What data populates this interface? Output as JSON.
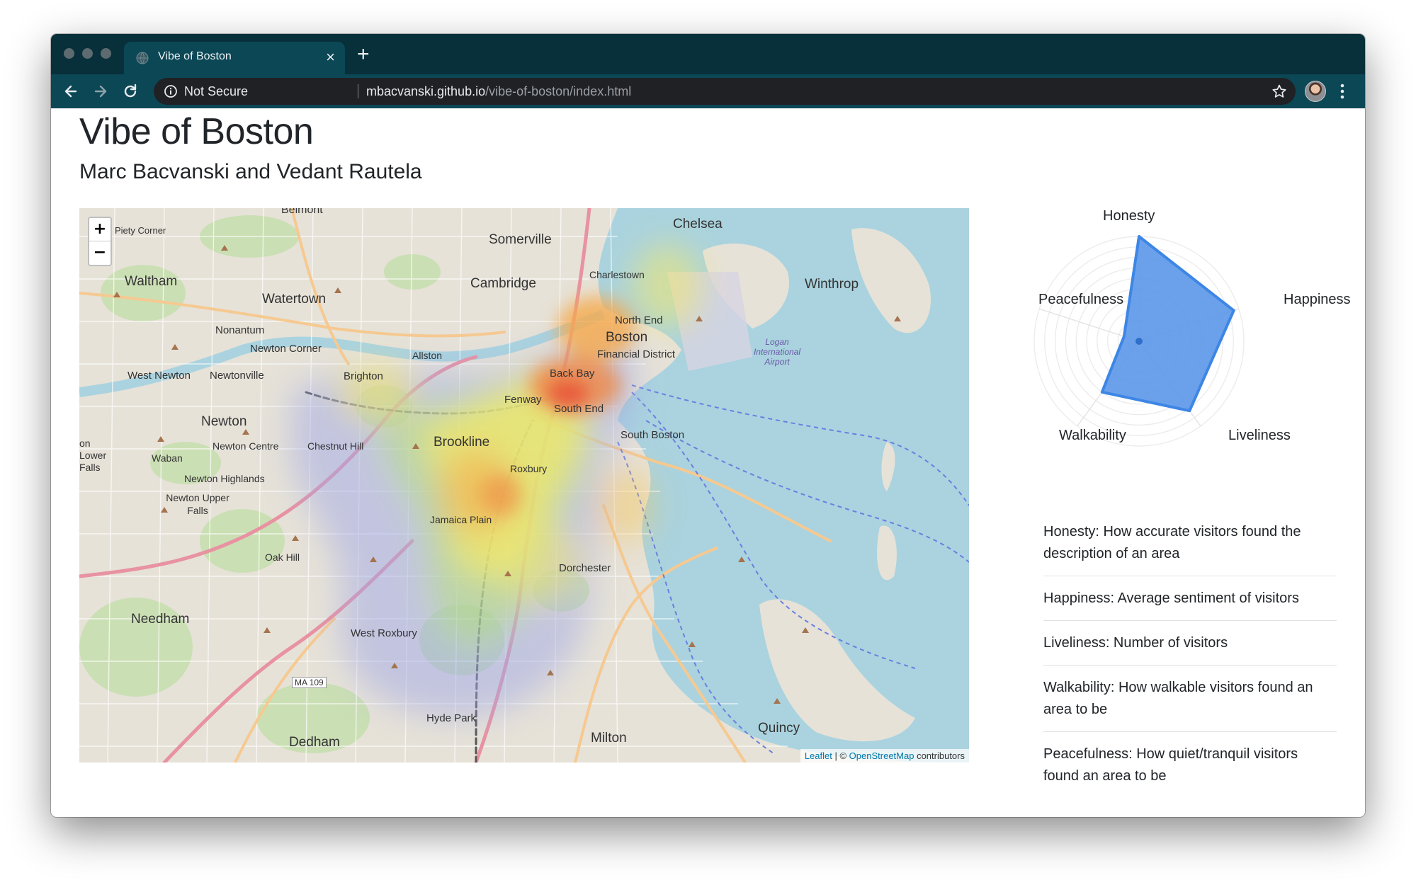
{
  "browser": {
    "tab_title": "Vibe of Boston",
    "tab_close": "×",
    "new_tab": "+",
    "security_label": "Not Secure",
    "url_host": "mbacvanski.github.io",
    "url_path": "/vibe-of-boston/index.html",
    "icons": [
      "back-arrow-icon",
      "forward-arrow-icon",
      "reload-icon",
      "info-icon",
      "star-icon",
      "kebab-menu-icon",
      "globe-icon"
    ]
  },
  "page": {
    "title": "Vibe of Boston",
    "subtitle": "Marc Bacvanski and Vedant Rautela"
  },
  "map": {
    "zoom_in": "+",
    "zoom_out": "−",
    "attribution": {
      "leaflet": "Leaflet",
      "separator": " | © ",
      "osm": "OpenStreetMap",
      "suffix": " contributors"
    },
    "place_labels": {
      "belmont": "Belmont",
      "piety_corner": "Piety Corner",
      "somerville": "Somerville",
      "chelsea": "Chelsea",
      "waltham": "Waltham",
      "watertown": "Watertown",
      "cambridge": "Cambridge",
      "charlestown": "Charlestown",
      "winthrop": "Winthrop",
      "nonantum": "Nonantum",
      "north_end": "North End",
      "boston": "Boston",
      "newton_corner": "Newton Corner",
      "allston": "Allston",
      "financial_district": "Financial District",
      "logan_airport": "Logan International Airport",
      "west_newton": "West Newton",
      "newtonville": "Newtonville",
      "brighton": "Brighton",
      "back_bay": "Back Bay",
      "fenway": "Fenway",
      "south_end": "South End",
      "newton": "Newton",
      "lower_falls": "on Lower Falls",
      "newton_centre": "Newton Centre",
      "chestnut_hill": "Chestnut Hill",
      "brookline": "Brookline",
      "south_boston": "South Boston",
      "waban": "Waban",
      "roxbury": "Roxbury",
      "newton_highlands": "Newton Highlands",
      "newton_upper_falls": "Newton Upper Falls",
      "jamaica_plain": "Jamaica Plain",
      "oak_hill": "Oak Hill",
      "dorchester": "Dorchester",
      "needham": "Needham",
      "west_roxbury": "West Roxbury",
      "ma109": "MA 109",
      "hyde_park": "Hyde Park",
      "quincy": "Quincy",
      "dedham": "Dedham",
      "milton": "Milton"
    }
  },
  "radar": {
    "axes": [
      "Honesty",
      "Happiness",
      "Liveliness",
      "Walkability",
      "Peacefulness"
    ],
    "values": [
      1.0,
      0.95,
      0.82,
      0.6,
      0.15
    ],
    "scale_max": 1.0,
    "fill_color": "#5b97e8",
    "stroke_color": "#3d86e6",
    "center_dot_color": "#2f6fcc"
  },
  "legend": {
    "items": [
      "Honesty: How accurate visitors found the description of an area",
      "Happiness: Average sentiment of visitors",
      "Liveliness: Number of visitors",
      "Walkability: How walkable visitors found an area to be",
      "Peacefulness: How quiet/tranquil visitors found an area to be"
    ]
  }
}
